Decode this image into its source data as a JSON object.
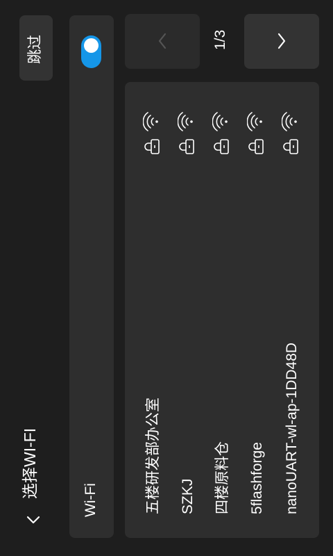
{
  "header": {
    "title": "选择WI-FI",
    "back_icon": "chevron-left-icon"
  },
  "skip": {
    "label": "跳过"
  },
  "wifi_toggle": {
    "label": "Wi-Fi",
    "enabled": true,
    "accent_color": "#1596e8"
  },
  "pagination": {
    "indicator": "1/3",
    "current_page": 1,
    "total_pages": 3,
    "prev_icon": "chevron-left-icon",
    "next_icon": "chevron-right-icon"
  },
  "networks": [
    {
      "ssid": "五楼研发部办公室",
      "secured": true,
      "signal_icon": "wifi-signal-icon",
      "lock_icon": "lock-icon"
    },
    {
      "ssid": "SZKJ",
      "secured": true,
      "signal_icon": "wifi-signal-icon",
      "lock_icon": "lock-icon"
    },
    {
      "ssid": "四楼原料仓",
      "secured": true,
      "signal_icon": "wifi-signal-icon",
      "lock_icon": "lock-icon"
    },
    {
      "ssid": "5flashforge",
      "secured": true,
      "signal_icon": "wifi-signal-icon",
      "lock_icon": "lock-icon"
    },
    {
      "ssid": "nanoUART-wl-ap-1DD48D",
      "secured": true,
      "signal_icon": "wifi-signal-icon",
      "lock_icon": "lock-icon"
    }
  ]
}
